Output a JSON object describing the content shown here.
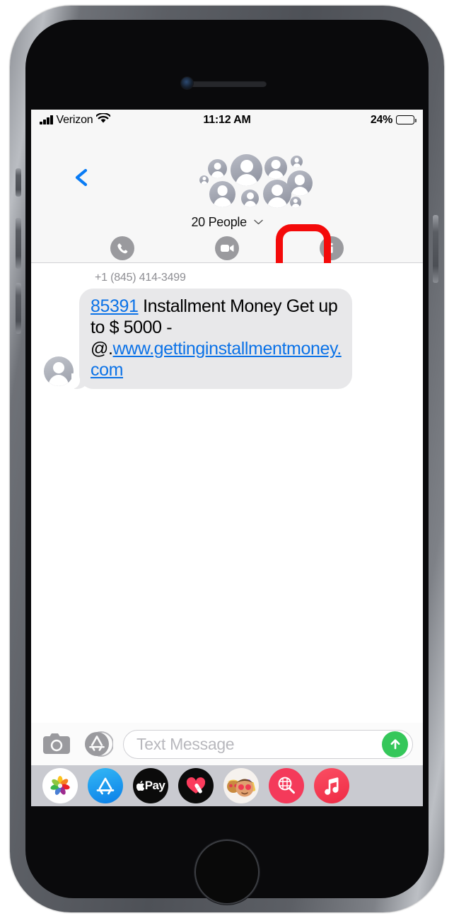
{
  "device": {
    "name": "iPhone",
    "home_button": "home-button"
  },
  "status_bar": {
    "carrier": "Verizon",
    "signal_icon": "signal-bars-icon",
    "wifi_icon": "wifi-icon",
    "time": "11:12 AM",
    "battery_percent": "24%",
    "battery_level": 24
  },
  "header": {
    "back_icon": "back-chevron-icon",
    "group_name": "20 People",
    "disclosure_icon": "chevron-down-icon",
    "participant_count": 20,
    "actions": [
      {
        "id": "audio",
        "label": "audio",
        "icon": "phone-icon",
        "highlighted": false
      },
      {
        "id": "facetime",
        "label": "FaceTime",
        "icon": "video-camera-icon",
        "highlighted": false
      },
      {
        "id": "info",
        "label": "info",
        "icon": "info-icon",
        "highlighted": true
      }
    ],
    "highlight_color": "#f40a0a"
  },
  "conversation": {
    "sender_label": "+1 (845) 414-3499",
    "message": {
      "link_code": "85391",
      "body_part1": " Installment Money Get up to $ 5000 - @.",
      "link_url": "www.gettinginstallmentmoney.com",
      "bubble_color": "#e8e8ea",
      "link_color": "#0b72e7"
    }
  },
  "input_bar": {
    "camera_icon": "camera-icon",
    "appstore_icon": "app-store-icon",
    "placeholder": "Text Message",
    "value": "",
    "send_icon": "send-arrow-up-icon",
    "send_color": "#35c75a"
  },
  "app_drawer": {
    "apps": [
      {
        "id": "photos",
        "name": "Photos"
      },
      {
        "id": "appstore",
        "name": "App Store"
      },
      {
        "id": "applepay",
        "name": "Apple Pay"
      },
      {
        "id": "digital-touch",
        "name": "Digital Touch"
      },
      {
        "id": "memoji",
        "name": "Memoji"
      },
      {
        "id": "images",
        "name": "#images"
      },
      {
        "id": "music",
        "name": "Music"
      }
    ]
  }
}
